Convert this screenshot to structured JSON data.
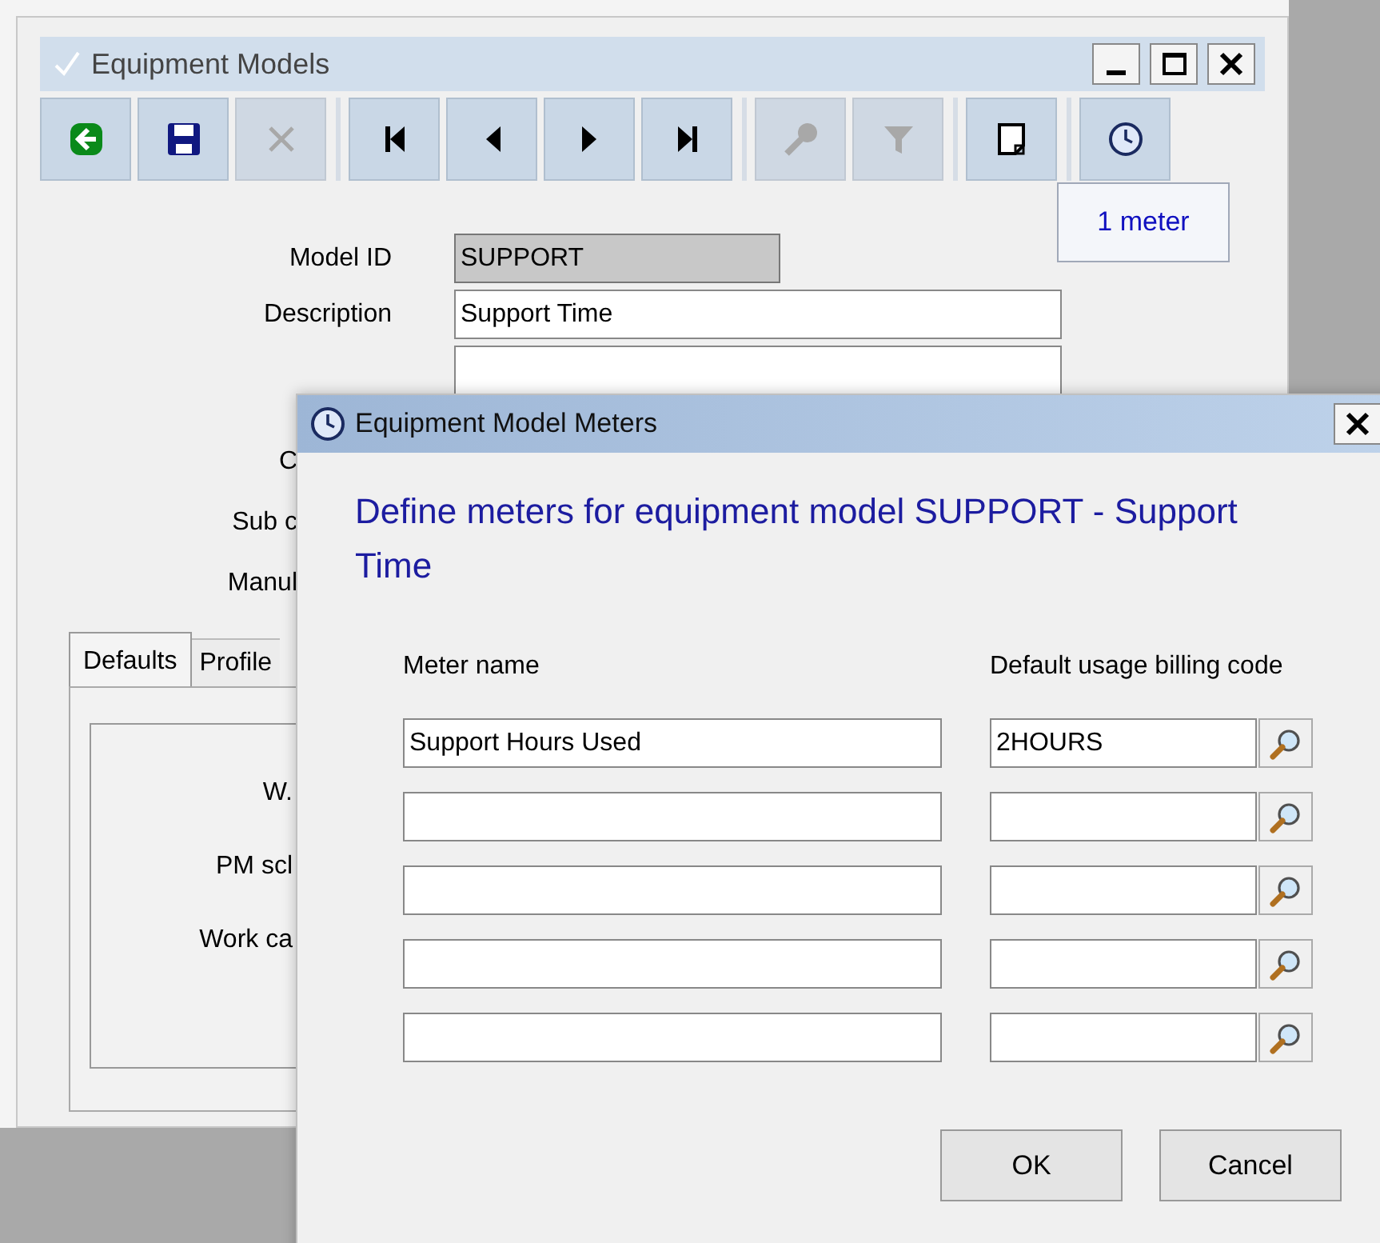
{
  "main_window": {
    "title": "Equipment Models",
    "toolbar": [
      [
        {
          "kind": "back",
          "disabled": false
        },
        {
          "kind": "save",
          "disabled": false
        },
        {
          "kind": "delete",
          "disabled": true
        }
      ],
      [
        {
          "kind": "first",
          "disabled": false
        },
        {
          "kind": "previous",
          "disabled": false
        },
        {
          "kind": "next",
          "disabled": false
        },
        {
          "kind": "last",
          "disabled": false
        }
      ],
      [
        {
          "kind": "key",
          "disabled": true
        },
        {
          "kind": "filter",
          "disabled": true
        }
      ],
      [
        {
          "kind": "note",
          "disabled": false
        }
      ],
      [
        {
          "kind": "clock",
          "disabled": false
        }
      ]
    ],
    "meter_button": "1 meter",
    "fields": [
      {
        "label": "Model ID",
        "value": "SUPPORT",
        "readonly": true
      },
      {
        "label": "Description",
        "value": "Support Time",
        "readonly": false
      }
    ],
    "partial_labels": [
      "C",
      "Sub c",
      "Manul"
    ],
    "tabs": [
      {
        "label": "Defaults",
        "selected": true
      },
      {
        "label": "Profile",
        "selected": false
      }
    ],
    "panel_labels": [
      "W.",
      "PM scl",
      "Work ca"
    ]
  },
  "dialog": {
    "title": "Equipment Model Meters",
    "heading": "Define meters for equipment model SUPPORT - Support Time",
    "columns": [
      "Meter name",
      "Default usage billing code"
    ],
    "rows": [
      {
        "meter_name": "Support Hours Used",
        "billing_code": "2HOURS"
      },
      {},
      {},
      {},
      {}
    ],
    "buttons": [
      "OK",
      "Cancel"
    ]
  }
}
